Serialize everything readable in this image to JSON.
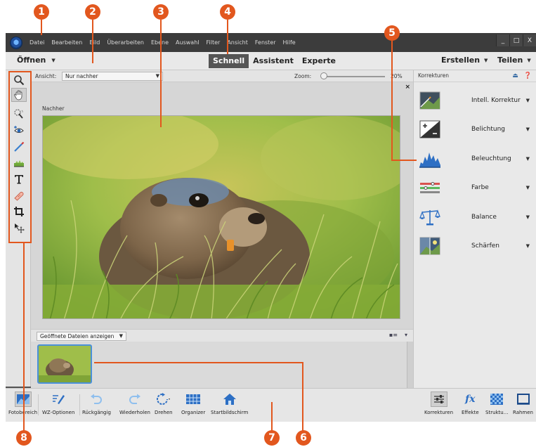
{
  "callouts": [
    {
      "number": "1"
    },
    {
      "number": "2"
    },
    {
      "number": "3"
    },
    {
      "number": "4"
    },
    {
      "number": "5"
    },
    {
      "number": "6"
    },
    {
      "number": "7"
    },
    {
      "number": "8"
    }
  ],
  "menu": {
    "items": [
      "Datei",
      "Bearbeiten",
      "Bild",
      "Überarbeiten",
      "Ebene",
      "Auswahl",
      "Filter",
      "Ansicht",
      "Fenster",
      "Hilfe"
    ],
    "window_controls": [
      "_",
      "□",
      "X"
    ]
  },
  "modebar": {
    "open_label": "Öffnen",
    "tabs": [
      {
        "label": "Schnell",
        "active": true
      },
      {
        "label": "Assistent",
        "active": false
      },
      {
        "label": "Experte",
        "active": false
      }
    ],
    "create_label": "Erstellen",
    "share_label": "Teilen"
  },
  "toolbar": {
    "tools": [
      "zoom-icon",
      "hand-icon",
      "quick-selection-icon",
      "red-eye-icon",
      "whiten-teeth-icon",
      "straighten-icon",
      "text-icon",
      "spot-healing-icon",
      "crop-icon",
      "move-icon"
    ]
  },
  "options": {
    "view_label": "Ansicht:",
    "view_value": "Nur nachher",
    "zoom_label": "Zoom:",
    "zoom_value": "20%"
  },
  "canvas": {
    "view_caption": "Nachher",
    "close_glyph": "×"
  },
  "photobin": {
    "select_value": "Geöffnete Dateien anzeigen"
  },
  "rpanel": {
    "title": "Korrekturen",
    "adjustments": [
      {
        "label": "Intell. Korrektur",
        "icon": "smart-fix-icon"
      },
      {
        "label": "Belichtung",
        "icon": "exposure-icon"
      },
      {
        "label": "Beleuchtung",
        "icon": "lighting-icon"
      },
      {
        "label": "Farbe",
        "icon": "color-icon"
      },
      {
        "label": "Balance",
        "icon": "balance-icon"
      },
      {
        "label": "Schärfen",
        "icon": "sharpen-icon"
      }
    ]
  },
  "bottombar": {
    "left": [
      {
        "label": "Fotobereich",
        "icon": "photo-bin-icon"
      },
      {
        "label": "WZ-Optionen",
        "icon": "tool-options-icon"
      },
      {
        "label": "Rückgängig",
        "icon": "undo-icon"
      },
      {
        "label": "Wiederholen",
        "icon": "redo-icon"
      },
      {
        "label": "Drehen",
        "icon": "rotate-icon"
      },
      {
        "label": "Organizer",
        "icon": "organizer-icon"
      },
      {
        "label": "Startbildschirm",
        "icon": "home-icon"
      }
    ],
    "right": [
      {
        "label": "Korrekturen",
        "icon": "adjustments-icon"
      },
      {
        "label": "Effekte",
        "icon": "effects-icon"
      },
      {
        "label": "Struktu...",
        "icon": "textures-icon"
      },
      {
        "label": "Rahmen",
        "icon": "frames-icon"
      }
    ]
  },
  "colors": {
    "callout": "#e2571e",
    "active_tab": "#555555",
    "selection_blue": "#4a90d9"
  }
}
